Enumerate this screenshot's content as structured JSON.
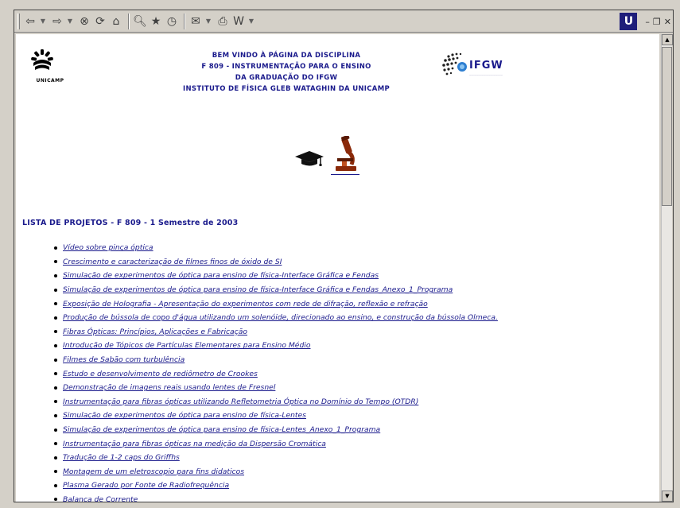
{
  "toolbar": {
    "icons": [
      "back-icon",
      "forward-icon",
      "stop-icon",
      "refresh-icon",
      "home-icon",
      "search-icon",
      "favorites-icon",
      "history-icon",
      "mail-icon",
      "print-icon",
      "edit-icon"
    ],
    "ie_logo": "U"
  },
  "header": {
    "title_lines": [
      "BEM VINDO À PÁGINA DA DISCIPLINA",
      "F 809 - INSTRUMENTAÇÃO PARA O ENSINO",
      "DA GRADUAÇÃO DO IFGW",
      "INSTITUTO DE FÍSICA GLEB WATAGHIN DA UNICAMP"
    ],
    "unicamp_label": "UNICAMP",
    "ifgw_label": "IFGW"
  },
  "list_title": "LISTA DE PROJETOS - F 809 - 1 Semestre de 2003",
  "projects": [
    "Vídeo sobre pinça óptica",
    "Crescimento e caracterização de filmes finos de óxido de SI",
    "Simulação de experimentos de óptica para ensino de física-Interface Gráfica e Fendas",
    "Simulação de experimentos de óptica para ensino de física-Interface Gráfica e Fendas_Anexo_1_Programa",
    "Exposição de Holografia - Apresentação do experimentos com rede de difração, reflexão e refração",
    "Produção de bússola de copo d'água utilizando um solenóide, direcionado ao ensino, e construção da bússola Olmeca.",
    "Fibras Ópticas: Princípios, Aplicações e Fabricação",
    "Introdução de Tópicos de Partículas Elementares para Ensino Médio",
    "Filmes de Sabão com turbulência",
    "Estudo e desenvolvimento de rediômetro de Crookes",
    "Demonstração de imagens reais usando lentes de Fresnel",
    "Instrumentação para fibras ópticas utilizando Refletometria Óptica no Domínio do Tempo (OTDR)",
    "Simulação de experimentos de óptica para ensino de física-Lentes",
    "Simulação de experimentos de óptica para ensino de física-Lentes_Anexo_1_Programa",
    "Instrumentação para fibras ópticas na medição da Dispersão Cromática",
    "Tradução de 1-2 caps do Griffhs",
    "Montagem de um eletroscopio para fins didaticos",
    "Plasma Gerado por Fonte de Radiofrequência",
    "Balança de Corrente"
  ]
}
